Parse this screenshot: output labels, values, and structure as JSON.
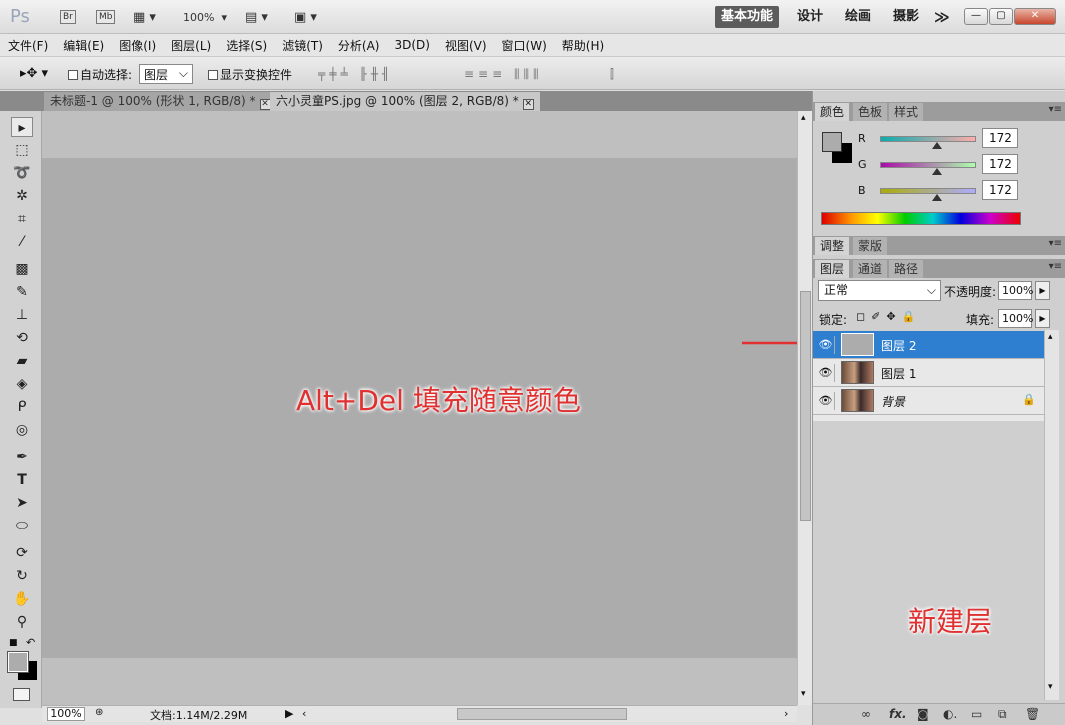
{
  "titlebar": {
    "logo": "Ps",
    "br": "Br",
    "mb": "Mb",
    "zoom": "100%",
    "workspaces": [
      "基本功能",
      "设计",
      "绘画",
      "摄影",
      "≫"
    ],
    "active_workspace": "基本功能"
  },
  "menu": {
    "items": [
      "文件(F)",
      "编辑(E)",
      "图像(I)",
      "图层(L)",
      "选择(S)",
      "滤镜(T)",
      "分析(A)",
      "3D(D)",
      "视图(V)",
      "窗口(W)",
      "帮助(H)"
    ]
  },
  "options": {
    "auto_select_label": "自动选择:",
    "auto_select_value": "图层",
    "show_transform_label": "显示变换控件"
  },
  "tabs": [
    {
      "label": "未标题-1 @ 100% (形状 1, RGB/8) *",
      "active": false
    },
    {
      "label": "六小灵童PS.jpg @ 100% (图层 2, RGB/8) *",
      "active": true
    }
  ],
  "annotations": {
    "main": "Alt+Del 填充随意颜色",
    "new_layer": "新建层"
  },
  "status": {
    "zoom": "100%",
    "doc_info": "文档:1.14M/2.29M"
  },
  "color_panel": {
    "tabs": [
      "颜色",
      "色板",
      "样式"
    ],
    "channels": [
      {
        "name": "R",
        "value": "172"
      },
      {
        "name": "G",
        "value": "172"
      },
      {
        "name": "B",
        "value": "172"
      }
    ],
    "fg_color": "#acacac",
    "bg_color": "#000000"
  },
  "adjust_panel": {
    "tabs": [
      "调整",
      "蒙版"
    ]
  },
  "layers_panel": {
    "tabs": [
      "图层",
      "通道",
      "路径"
    ],
    "blend_mode": "正常",
    "opacity_label": "不透明度:",
    "opacity_value": "100%",
    "lock_label": "锁定:",
    "fill_label": "填充:",
    "fill_value": "100%",
    "layers": [
      {
        "name": "图层 2",
        "selected": true
      },
      {
        "name": "图层 1",
        "selected": false
      },
      {
        "name": "背景",
        "selected": false
      }
    ]
  },
  "accent_color": "#2f7fd1",
  "annotation_color": "#e03030"
}
